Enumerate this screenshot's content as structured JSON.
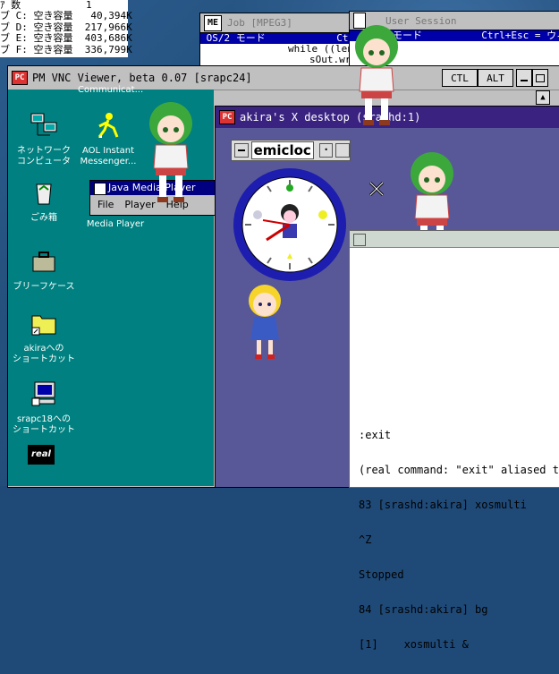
{
  "disk_panel": {
    "lines": [
      "ｱ 数           1",
      "ブ C: 空き容量   40,394K",
      "ブ D: 空き容量  217,966K",
      "ブ E: 空き容量  403,686K",
      "ブ F: 空き容量  336,799K"
    ]
  },
  "job_window": {
    "badge": "ME",
    "title": "Job [MPEG3]",
    "menu_line": " OS/2 モード            Ctrl+",
    "code_lines": [
      "while ((len",
      "sOut.wr"
    ]
  },
  "user_session": {
    "title": "User Session",
    "menu_line": "モード          Ctrl+Esc = ウィン"
  },
  "vnc": {
    "title": "PM VNC Viewer, beta 0.07 [srapc24]",
    "ctl_label": "CTL",
    "alt_label": "ALT",
    "sticky_label": "Communicat..."
  },
  "win95_icons": [
    {
      "label": "ネットワーク\nコンピュータ",
      "icon": "network-computer-icon"
    },
    {
      "label": "AOL Instant\nMessenger...",
      "icon": "aol-messenger-icon"
    },
    {
      "label": "ごみ箱",
      "icon": "recycle-bin-icon"
    },
    {
      "label": "ブリーフケース",
      "icon": "briefcase-icon"
    },
    {
      "label": "akiraへの\nショートカット",
      "icon": "folder-shortcut-icon"
    },
    {
      "label": "srapc18への\nショートカット",
      "icon": "computer-shortcut-icon"
    },
    {
      "label": "Windows\nMedia Player",
      "icon": "media-player-icon"
    },
    {
      "label": "real",
      "icon": "real-player-icon"
    }
  ],
  "jmf": {
    "title": "Java Media Player",
    "menu": [
      "File",
      "Player",
      "Help"
    ]
  },
  "xdesktop": {
    "title": "akira's X desktop (srashd:1)",
    "emiclock_label": "emicloc"
  },
  "terminal": {
    "lines": [
      ":exit",
      "(real command: \"exit\" aliased to",
      "83 [srashd:akira] xosmulti",
      "^Z",
      "Stopped",
      "84 [srashd:akira] bg",
      "[1]    xosmulti &"
    ]
  },
  "colors": {
    "teal": "#008080",
    "xbg": "#585898",
    "os2blue": "#0000a8"
  }
}
